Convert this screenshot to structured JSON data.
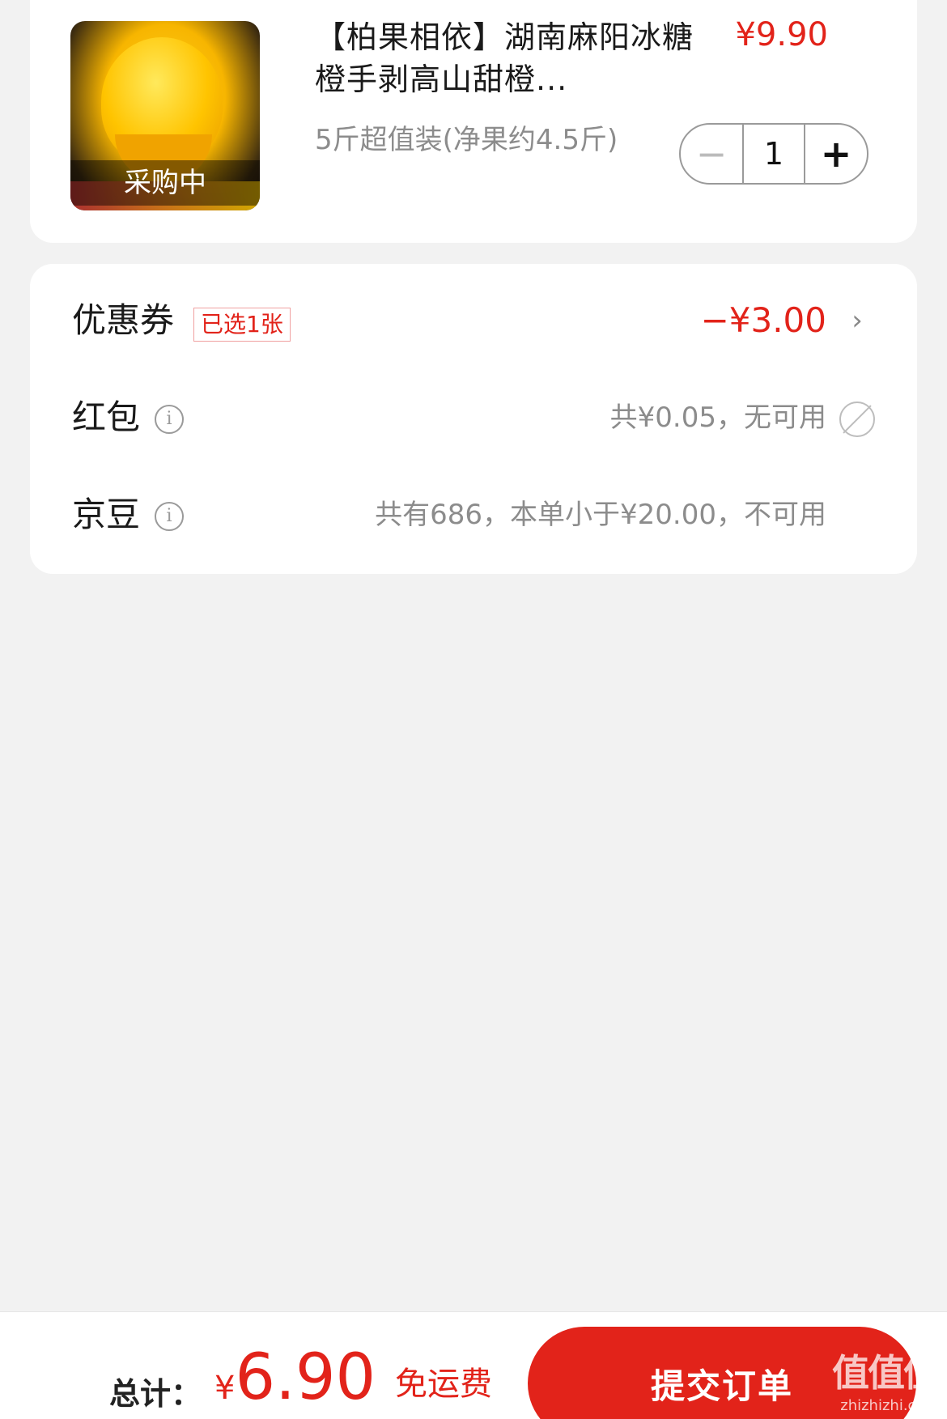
{
  "product": {
    "title": "【柏果相依】湖南麻阳冰糖橙手剥高山甜橙...",
    "price": "¥9.90",
    "spec": "5斤超值装(净果约4.5斤)",
    "image_badge": "采购中",
    "quantity": "1",
    "minus_symbol": "−",
    "plus_symbol": "+"
  },
  "discounts": {
    "coupon": {
      "label": "优惠券",
      "tag": "已选1张",
      "value": "−¥3.00"
    },
    "red_packet": {
      "label": "红包",
      "value": "共¥0.05，无可用"
    },
    "jd_beans": {
      "label": "京豆",
      "value": "共有686，本单小于¥20.00，不可用"
    }
  },
  "footer": {
    "total_label": "总计：",
    "currency": "¥",
    "total_value": "6.90",
    "shipping": "免运费",
    "submit_label": "提交订单"
  },
  "watermark": {
    "mark": "值值值",
    "url": "zhizhizhi.com"
  },
  "colors": {
    "accent": "#e2231a",
    "background": "#f2f2f2",
    "muted": "#8c8c8c"
  }
}
